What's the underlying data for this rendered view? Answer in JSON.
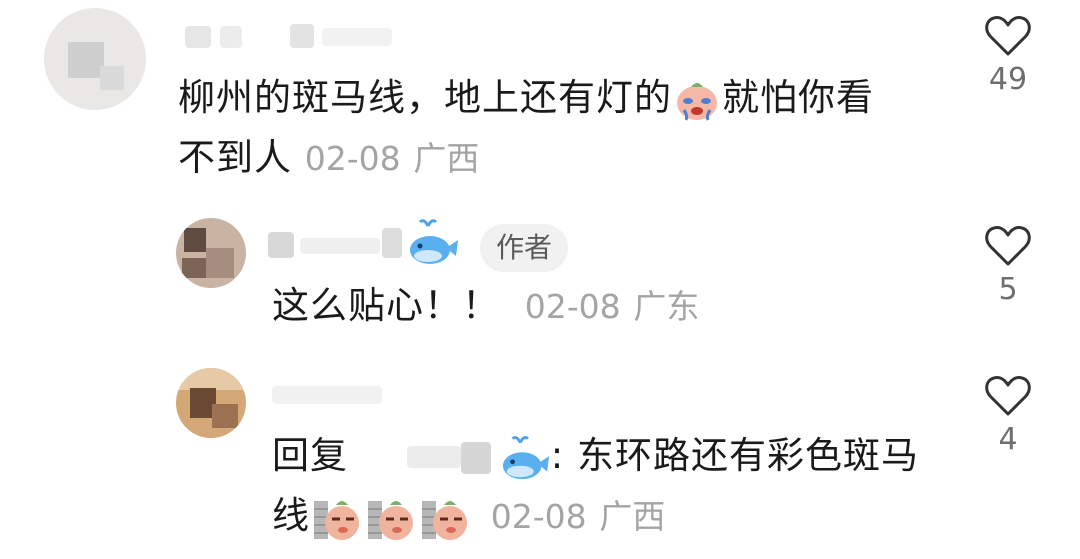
{
  "comments": [
    {
      "text_line1": "柳州的斑马线，地上还有灯的",
      "text_line1b": "就怕你看",
      "text_line2": "不到人",
      "date": "02-08",
      "location": "广西",
      "likes": "49",
      "emoji": "crying-face-emoji"
    },
    {
      "badge": "作者",
      "text": "这么贴心！！",
      "date": "02-08",
      "location": "广东",
      "likes": "5",
      "name_emoji": "whale-emoji"
    },
    {
      "reply_prefix": "回复",
      "reply_name_emoji": "whale-emoji",
      "text_line1": ": 东环路还有彩色斑马",
      "text_line2": "线",
      "date": "02-08",
      "location": "广西",
      "likes": "4",
      "emoji": "peeking-face-emoji"
    }
  ],
  "colors": {
    "meta": "#a4a4a4",
    "badge_bg": "#f1f1f1",
    "heart": "#333333"
  }
}
